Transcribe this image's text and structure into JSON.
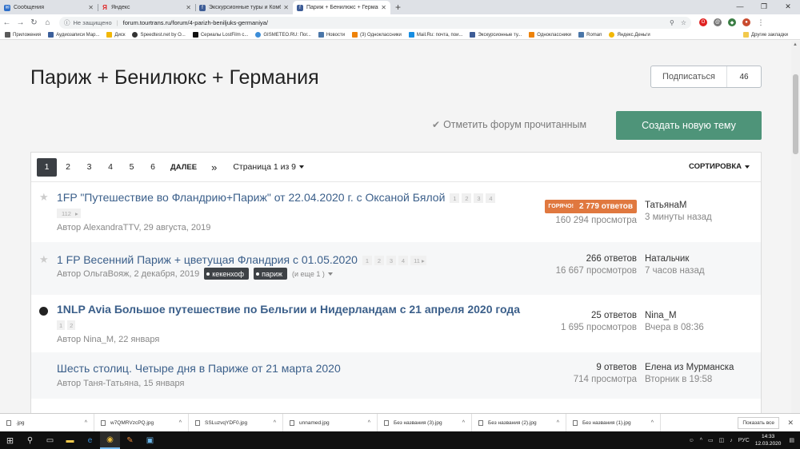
{
  "browser": {
    "tabs": [
      {
        "label": "Сообщения",
        "color": "#2d6ec9",
        "active": false
      },
      {
        "label": "Яндекс",
        "color": "#e02020",
        "active": false
      },
      {
        "label": "Экскурсионные туры и Комби",
        "color": "#3d5c96",
        "active": false
      },
      {
        "label": "Париж + Бенилюкс + Германи",
        "color": "#3d5c96",
        "active": true
      }
    ],
    "new_tab": "+",
    "window_controls": [
      "—",
      "❐",
      "✕"
    ],
    "omnibox": {
      "security": "Не защищено",
      "url": "forum.tourtrans.ru/forum/4-parizh-beniljuks-germaniya/"
    },
    "bookmarks": [
      {
        "label": "Приложения",
        "color": "#5a5a5a"
      },
      {
        "label": "Аудиозаписи Мар...",
        "color": "#3b5f9a"
      },
      {
        "label": "Диск",
        "color": "#f2b705"
      },
      {
        "label": "Speedtest.net by O...",
        "color": "#333333"
      },
      {
        "label": "Сериалы LostFilm c...",
        "color": "#111111"
      },
      {
        "label": "GISMETEO.RU: Пог...",
        "color": "#3c8dd8"
      },
      {
        "label": "Новости",
        "color": "#4a76a8"
      },
      {
        "label": "(3) Одноклассники",
        "color": "#ee8208"
      },
      {
        "label": "Mail.Ru: почта, пои...",
        "color": "#168de2"
      },
      {
        "label": "Экскурсионные ту...",
        "color": "#3d5c96"
      },
      {
        "label": "Одноклассники",
        "color": "#ee8208"
      },
      {
        "label": "Roman",
        "color": "#4a76a8"
      },
      {
        "label": "Яндекс.Деньги",
        "color": "#f2b705"
      }
    ],
    "other_bookmarks": "Другие закладки"
  },
  "forum": {
    "title": "Париж + Бенилюкс + Германия",
    "follow_label": "Подписаться",
    "follow_count": "46",
    "mark_read": "Отметить форум прочитанным",
    "create_topic": "Создать новую тему",
    "pagination": {
      "pages": [
        "1",
        "2",
        "3",
        "4",
        "5",
        "6"
      ],
      "next": "ДАЛЕЕ",
      "last": "»",
      "page_of": "Страница 1 из 9",
      "sort": "СОРТИРОВКА"
    },
    "topics": [
      {
        "title": "1FP \"Путешествие во Фландрию+Париж\" от 22.04.2020 г. с Оксаной Бялой",
        "pages": [
          "1",
          "2",
          "3",
          "4"
        ],
        "pages_extra": "112",
        "author_line": "Автор AlexandraTTV, 29 августа, 2019",
        "hot_label": "ГОРЯЧО!",
        "replies": "2 779 ответов",
        "views": "160 294 просмотра",
        "last_author": "ТатьянаМ",
        "last_time": "3 минуты назад"
      },
      {
        "title": "1 FP Весенний Париж + цветущая Фландрия с 01.05.2020",
        "pages": [
          "1",
          "2",
          "3",
          "4",
          "11"
        ],
        "author_line": "Автор ОльгаВояж, 2 декабря, 2019",
        "tags": [
          "кекенхоф",
          "париж"
        ],
        "tags_more": "(и еще 1 )",
        "replies": "266 ответов",
        "views": "16 667 просмотров",
        "last_author": "Натальчик",
        "last_time": "7 часов назад"
      },
      {
        "title": "1NLP Avia Большое путешествие по Бельгии и Нидерландам с 21 апреля 2020 года",
        "pages": [
          "1",
          "2"
        ],
        "author_line": "Автор Nina_M, 22 января",
        "replies": "25 ответов",
        "views": "1 695 просмотров",
        "last_author": "Nina_M",
        "last_time": "Вчера в 08:36"
      },
      {
        "title": "Шесть столиц. Четыре дня в Париже от 21 марта 2020",
        "author_line": "Автор Таня-Татьяна, 15 января",
        "replies": "9 ответов",
        "views": "714 просмотра",
        "last_author": "Елена из Мурманска",
        "last_time": "Вторник в 19:58"
      }
    ]
  },
  "downloads": {
    "items": [
      ".jpg",
      "w7QMRVzcPQ.jpg",
      "SSLuzvqYDF0.jpg",
      "unnamed.jpg",
      "Без названия (3).jpg",
      "Без названия (2).jpg",
      "Без названия (1).jpg"
    ],
    "show_all": "Показать все"
  },
  "taskbar": {
    "lang": "РУС",
    "time": "14:33",
    "date": "12.03.2020"
  }
}
